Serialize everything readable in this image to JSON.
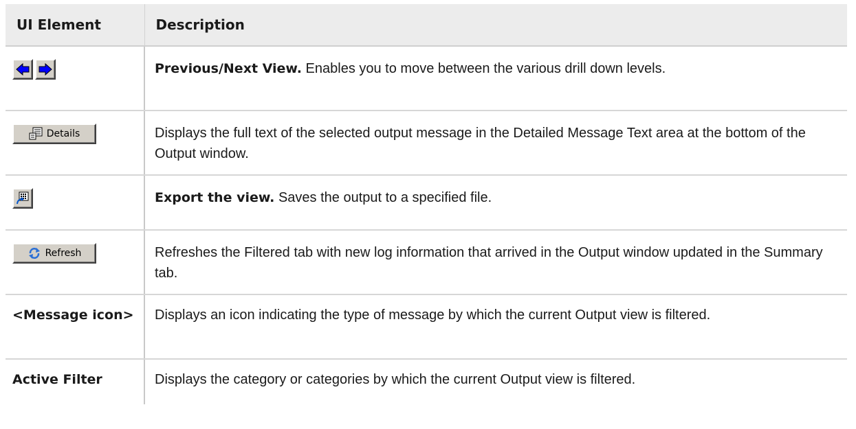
{
  "header": {
    "col1": "UI Element",
    "col2": "Description"
  },
  "rows": [
    {
      "element_icons": [
        "left-arrow-icon",
        "right-arrow-icon"
      ],
      "title": "Previous/Next View.",
      "text": " Enables you to move between the various drill down levels."
    },
    {
      "element_icons": [
        "details-icon"
      ],
      "button_label": "Details",
      "title": "",
      "text": "Displays the full text of the selected output message in the Detailed Message Text area at the bottom of the Output window."
    },
    {
      "element_icons": [
        "export-icon"
      ],
      "title": "Export the view.",
      "text": " Saves the output to a specified file."
    },
    {
      "element_icons": [
        "refresh-icon"
      ],
      "button_label": "Refresh",
      "title": "",
      "text": "Refreshes the Filtered tab with new log information that arrived in the Output window updated in the Summary tab."
    },
    {
      "element_label": "<Message icon>",
      "title": "",
      "text": "Displays an icon indicating the type of message by which the current Output view is filtered."
    },
    {
      "element_label": "Active Filter",
      "title": "",
      "text": "Displays the category or categories by which the current Output view is filtered."
    }
  ],
  "colors": {
    "header_bg": "#ececec",
    "button_face": "#d4d0c8",
    "arrow_blue": "#0000ff"
  }
}
